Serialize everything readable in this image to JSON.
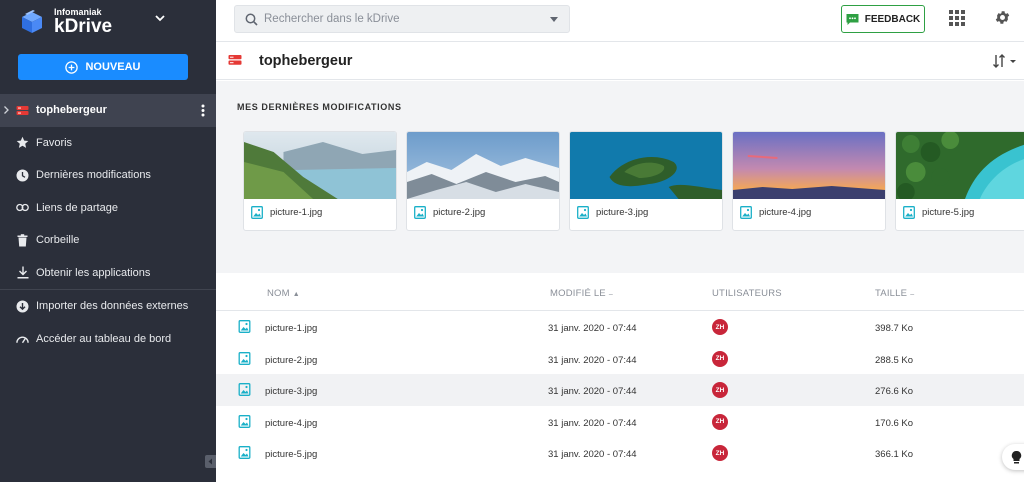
{
  "brand": {
    "company": "Infomaniak",
    "product": "kDrive"
  },
  "sidebar": {
    "new_button_label": "NOUVEAU",
    "items": [
      {
        "label": "tophebergeur",
        "icon": "drive-icon"
      },
      {
        "label": "Favoris",
        "icon": "star-icon"
      },
      {
        "label": "Dernières modifications",
        "icon": "clock-icon"
      },
      {
        "label": "Liens de partage",
        "icon": "link-icon"
      },
      {
        "label": "Corbeille",
        "icon": "trash-icon"
      },
      {
        "label": "Obtenir les applications",
        "icon": "download-icon"
      },
      {
        "label": "Importer des données externes",
        "icon": "import-icon"
      },
      {
        "label": "Accéder au tableau de bord",
        "icon": "dashboard-icon"
      }
    ]
  },
  "topbar": {
    "search_placeholder": "Rechercher dans le kDrive",
    "feedback_label": "FEEDBACK"
  },
  "page": {
    "title": "tophebergeur"
  },
  "recent": {
    "title": "MES DERNIÈRES MODIFICATIONS",
    "cards": [
      {
        "name": "picture-1.jpg"
      },
      {
        "name": "picture-2.jpg"
      },
      {
        "name": "picture-3.jpg"
      },
      {
        "name": "picture-4.jpg"
      },
      {
        "name": "picture-5.jpg"
      }
    ]
  },
  "table": {
    "headers": {
      "name": "NOM",
      "modified": "MODIFIÉ LE",
      "users": "UTILISATEURS",
      "size": "TAILLE"
    },
    "rows": [
      {
        "name": "picture-1.jpg",
        "modified": "31 janv. 2020 - 07:44",
        "user": "ZH",
        "size": "398.7 Ko"
      },
      {
        "name": "picture-2.jpg",
        "modified": "31 janv. 2020 - 07:44",
        "user": "ZH",
        "size": "288.5 Ko"
      },
      {
        "name": "picture-3.jpg",
        "modified": "31 janv. 2020 - 07:44",
        "user": "ZH",
        "size": "276.6 Ko"
      },
      {
        "name": "picture-4.jpg",
        "modified": "31 janv. 2020 - 07:44",
        "user": "ZH",
        "size": "170.6 Ko"
      },
      {
        "name": "picture-5.jpg",
        "modified": "31 janv. 2020 - 07:44",
        "user": "ZH",
        "size": "366.1 Ko"
      }
    ]
  },
  "colors": {
    "accent": "#1a8cff",
    "sidebar": "#2b2f3a",
    "feedback_border": "#2ea043",
    "avatar": "#c8263a",
    "file_icon": "#1ab0c8",
    "drive": "#e53935"
  }
}
